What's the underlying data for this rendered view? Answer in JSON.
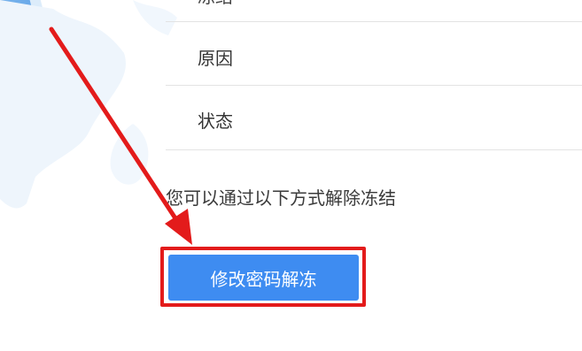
{
  "rows": {
    "top_partial_label": "冻结",
    "reason_label": "原因",
    "status_label": "状态"
  },
  "hint": "您可以通过以下方式解除冻结",
  "unfreeze_button_label": "修改密码解冻",
  "colors": {
    "button": "#3e8cf1",
    "annotation": "#e31b1b",
    "divider": "#e3e3e3"
  },
  "icons": {
    "background": "globe-icon",
    "annotation": "red-arrow-icon"
  }
}
